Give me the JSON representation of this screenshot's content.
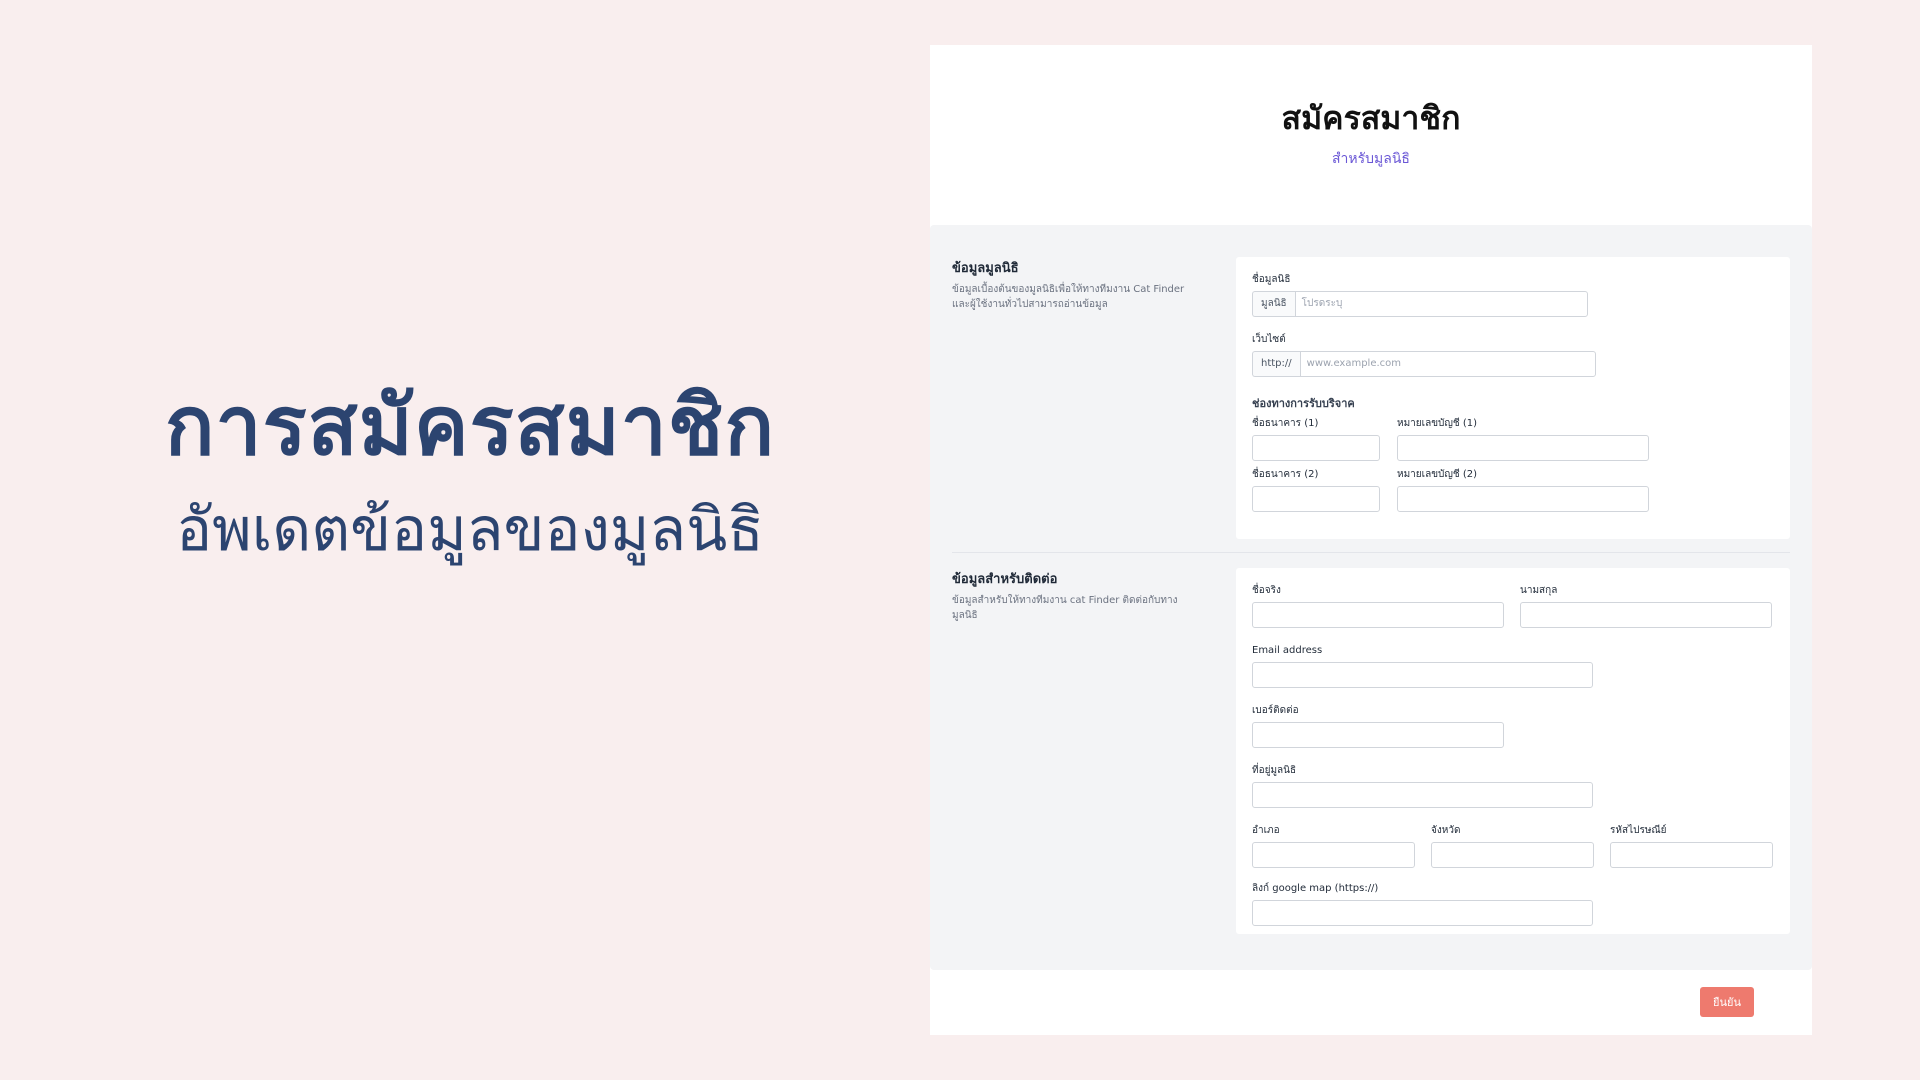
{
  "hero": {
    "title": "การสมัครสมาชิก",
    "subtitle": "อัพเดตข้อมูลของมูลนิธิ"
  },
  "form": {
    "title": "สมัครสมาชิก",
    "subtitle": "สำหรับมูลนิธิ",
    "section_foundation": {
      "title": "ข้อมูลมูลนิธิ",
      "description": "ข้อมูลเบื้องต้นของมูลนิธิเพื่อให้ทางทีมงาน Cat Finder และผู้ใช้งานทั่วไปสามารถอ่านข้อมูล",
      "name_label": "ชื่อมูลนิธิ",
      "name_prefix": "มูลนิธิ",
      "name_placeholder": "โปรดระบุ",
      "website_label": "เว็บไซต์",
      "website_prefix": "http://",
      "website_placeholder": "www.example.com",
      "donation_title": "ช่องทางการรับบริจาค",
      "bank1_label": "ชื่อธนาคาร (1)",
      "account1_label": "หมายเลขบัญชี (1)",
      "bank2_label": "ชื่อธนาคาร (2)",
      "account2_label": "หมายเลขบัญชี (2)"
    },
    "section_contact": {
      "title": "ข้อมูลสำหรับติดต่อ",
      "description": "ข้อมูลสำหรับให้ทางทีมงาน cat Finder ติดต่อกับทางมูลนิธิ",
      "first_name_label": "ชื่อจริง",
      "last_name_label": "นามสกุล",
      "email_label": "Email address",
      "phone_label": "เบอร์ติดต่อ",
      "address_label": "ที่อยู่มูลนิธิ",
      "district_label": "อำเภอ",
      "province_label": "จังหวัด",
      "postal_label": "รหัสไปรษณีย์",
      "map_label": "ลิงก์ google map (https://)"
    },
    "submit_label": "ยืนยัน"
  },
  "colors": {
    "background": "#f9eeee",
    "hero_text": "#2c4470",
    "accent_subtitle": "#6b58d6",
    "submit_button": "#ee7a6e"
  }
}
